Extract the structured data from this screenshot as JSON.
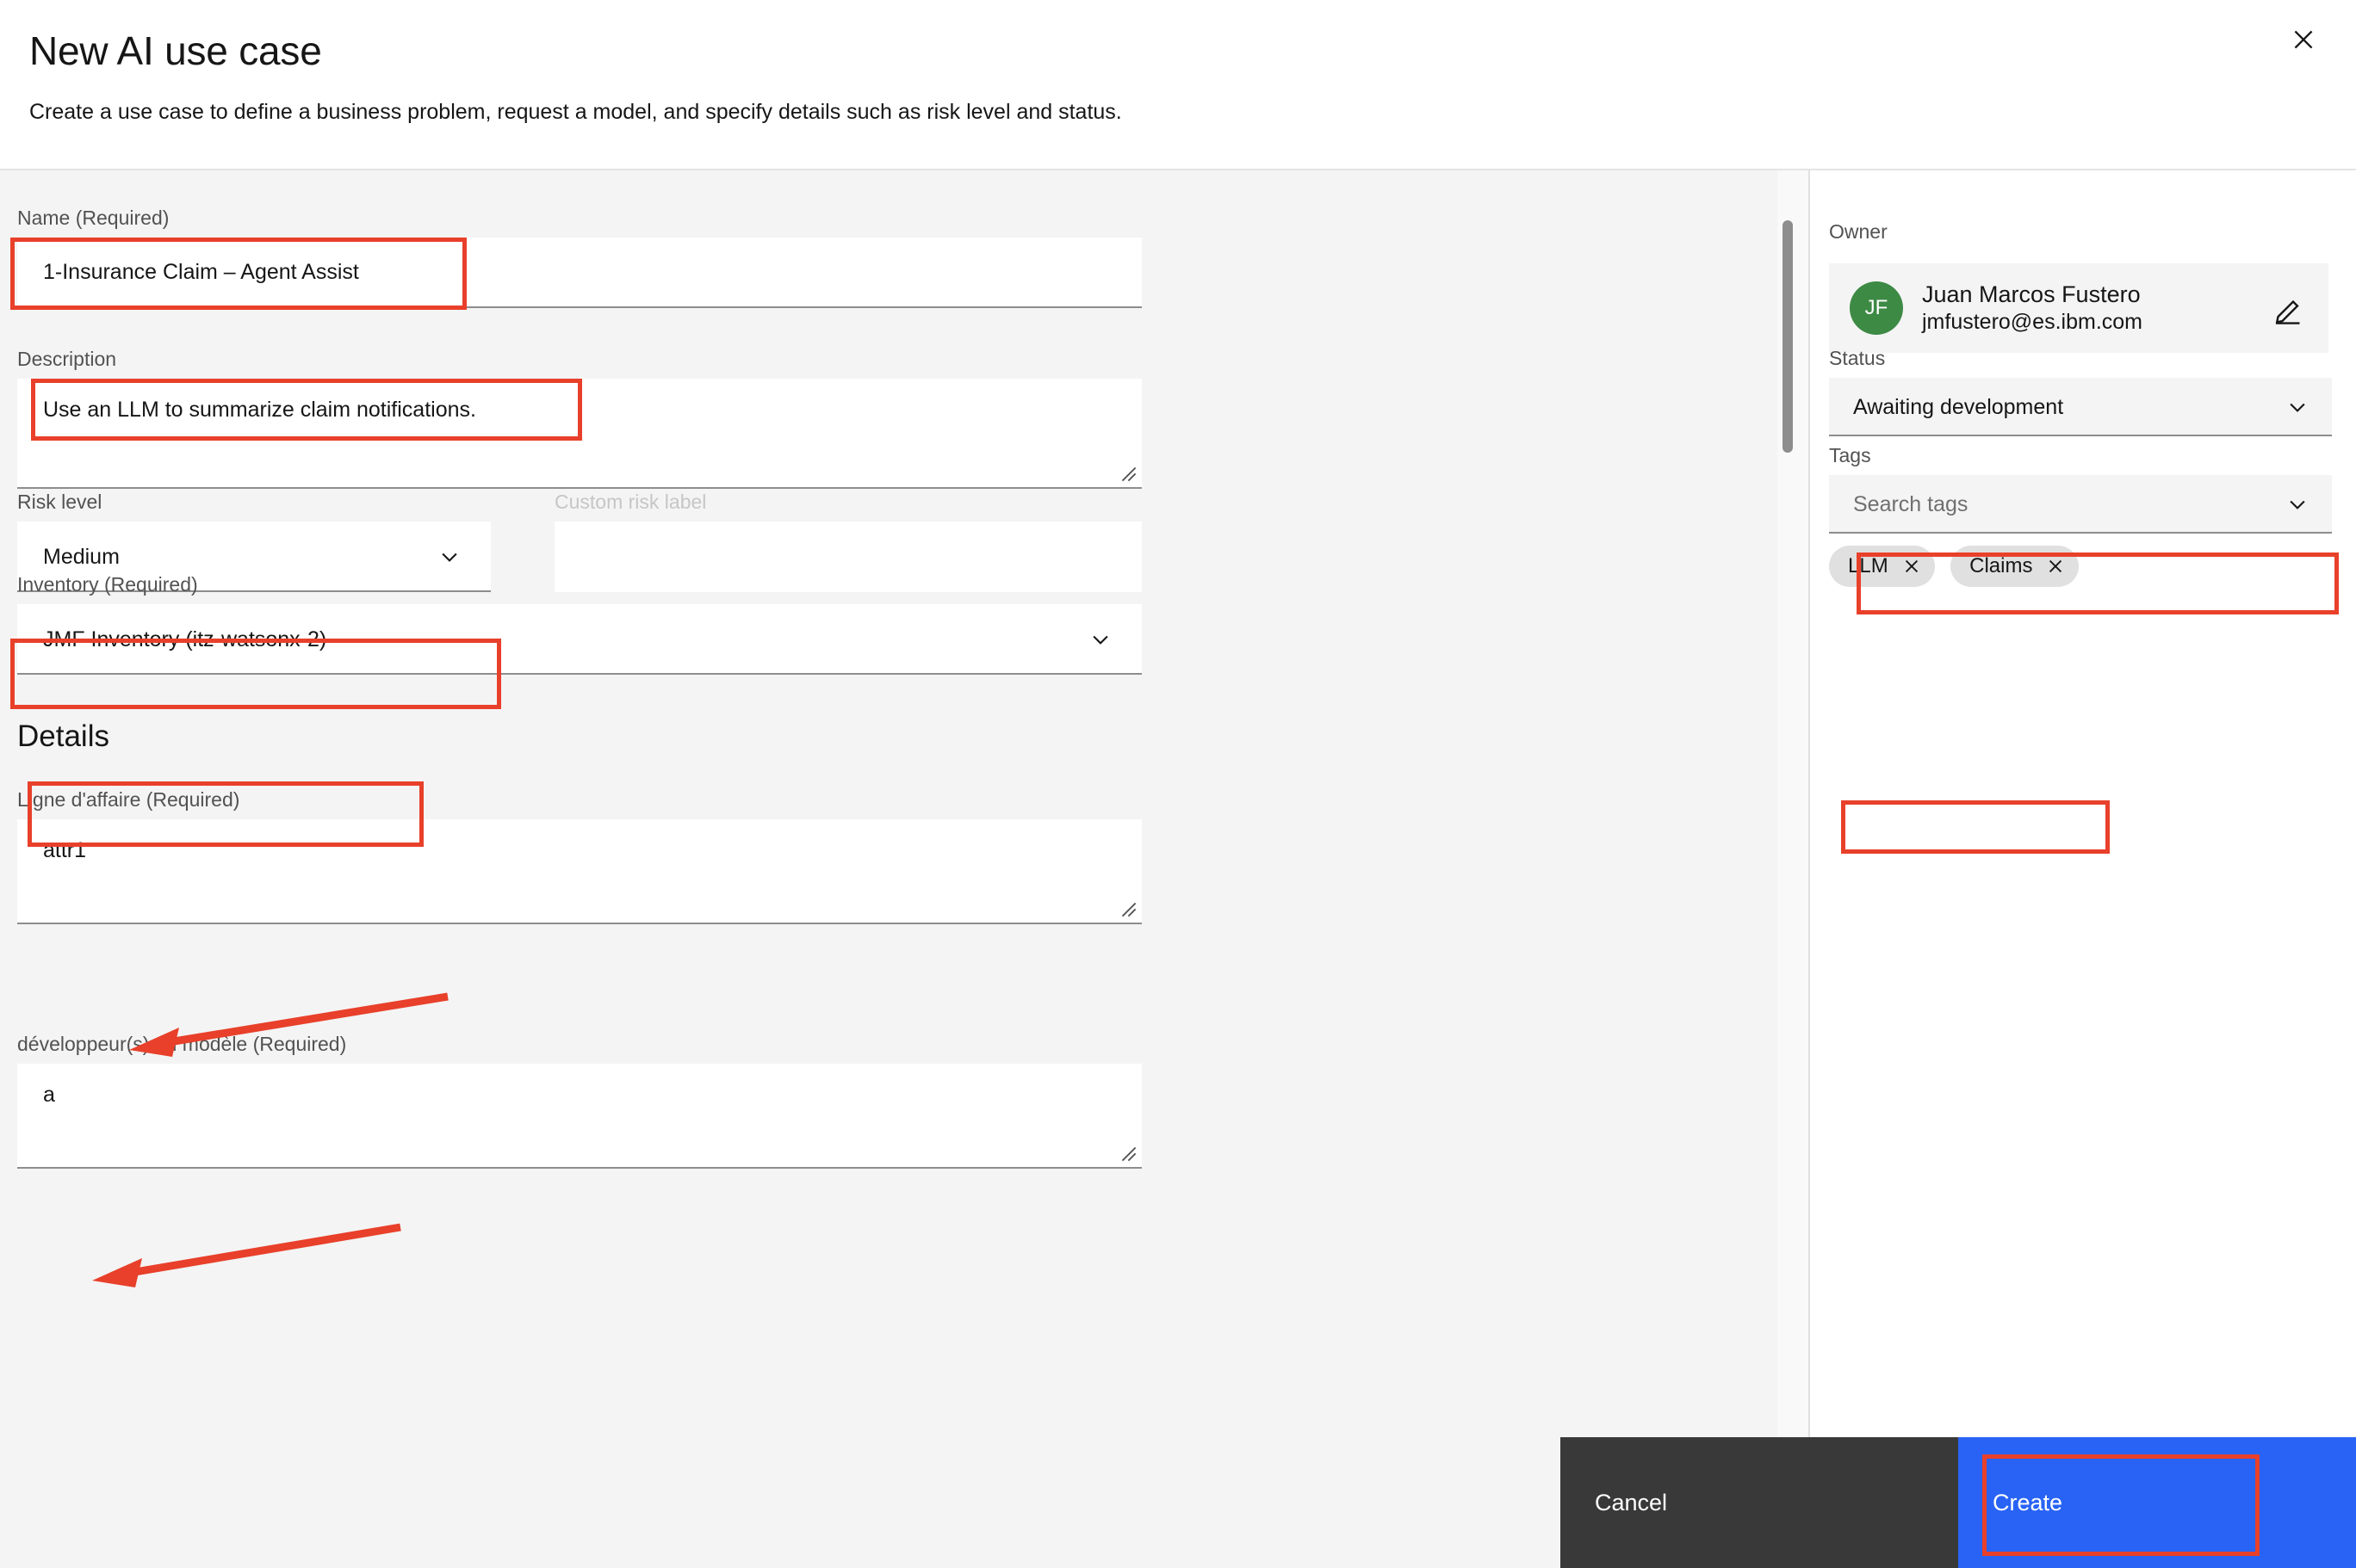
{
  "header": {
    "title": "New AI use case",
    "subtitle": "Create a use case to define a business problem, request a model, and specify details such as risk level and status.",
    "close_icon": "close-icon"
  },
  "form": {
    "name": {
      "label": "Name (Required)",
      "value": "1-Insurance Claim – Agent Assist"
    },
    "description": {
      "label": "Description",
      "value": "Use an LLM to summarize claim notifications."
    },
    "risk_level": {
      "label": "Risk level",
      "value": "Medium"
    },
    "custom_risk_label": {
      "label": "Custom risk label",
      "value": "",
      "disabled": true
    },
    "inventory": {
      "label": "Inventory (Required)",
      "value": "JMF Inventory (itz-watsonx-2)"
    }
  },
  "details": {
    "heading": "Details",
    "fields": [
      {
        "label": "Ligne d'affaire (Required)",
        "value": "attr1"
      },
      {
        "label": "développeur(s) du modèle (Required)",
        "value": "a"
      }
    ]
  },
  "sidebar": {
    "owner": {
      "label": "Owner",
      "initials": "JF",
      "name": "Juan Marcos Fustero",
      "email": "jmfustero@es.ibm.com",
      "edit_icon": "edit-pencil-icon",
      "avatar_color": "#3d8a45"
    },
    "status": {
      "label": "Status",
      "value": "Awaiting development"
    },
    "tags": {
      "label": "Tags",
      "placeholder": "Search tags",
      "chips": [
        "LLM",
        "Claims"
      ]
    }
  },
  "footer": {
    "cancel_label": "Cancel",
    "create_label": "Create",
    "create_color": "#2863f5",
    "cancel_color": "#393939"
  },
  "annotations": {
    "color": "#e8402a"
  }
}
